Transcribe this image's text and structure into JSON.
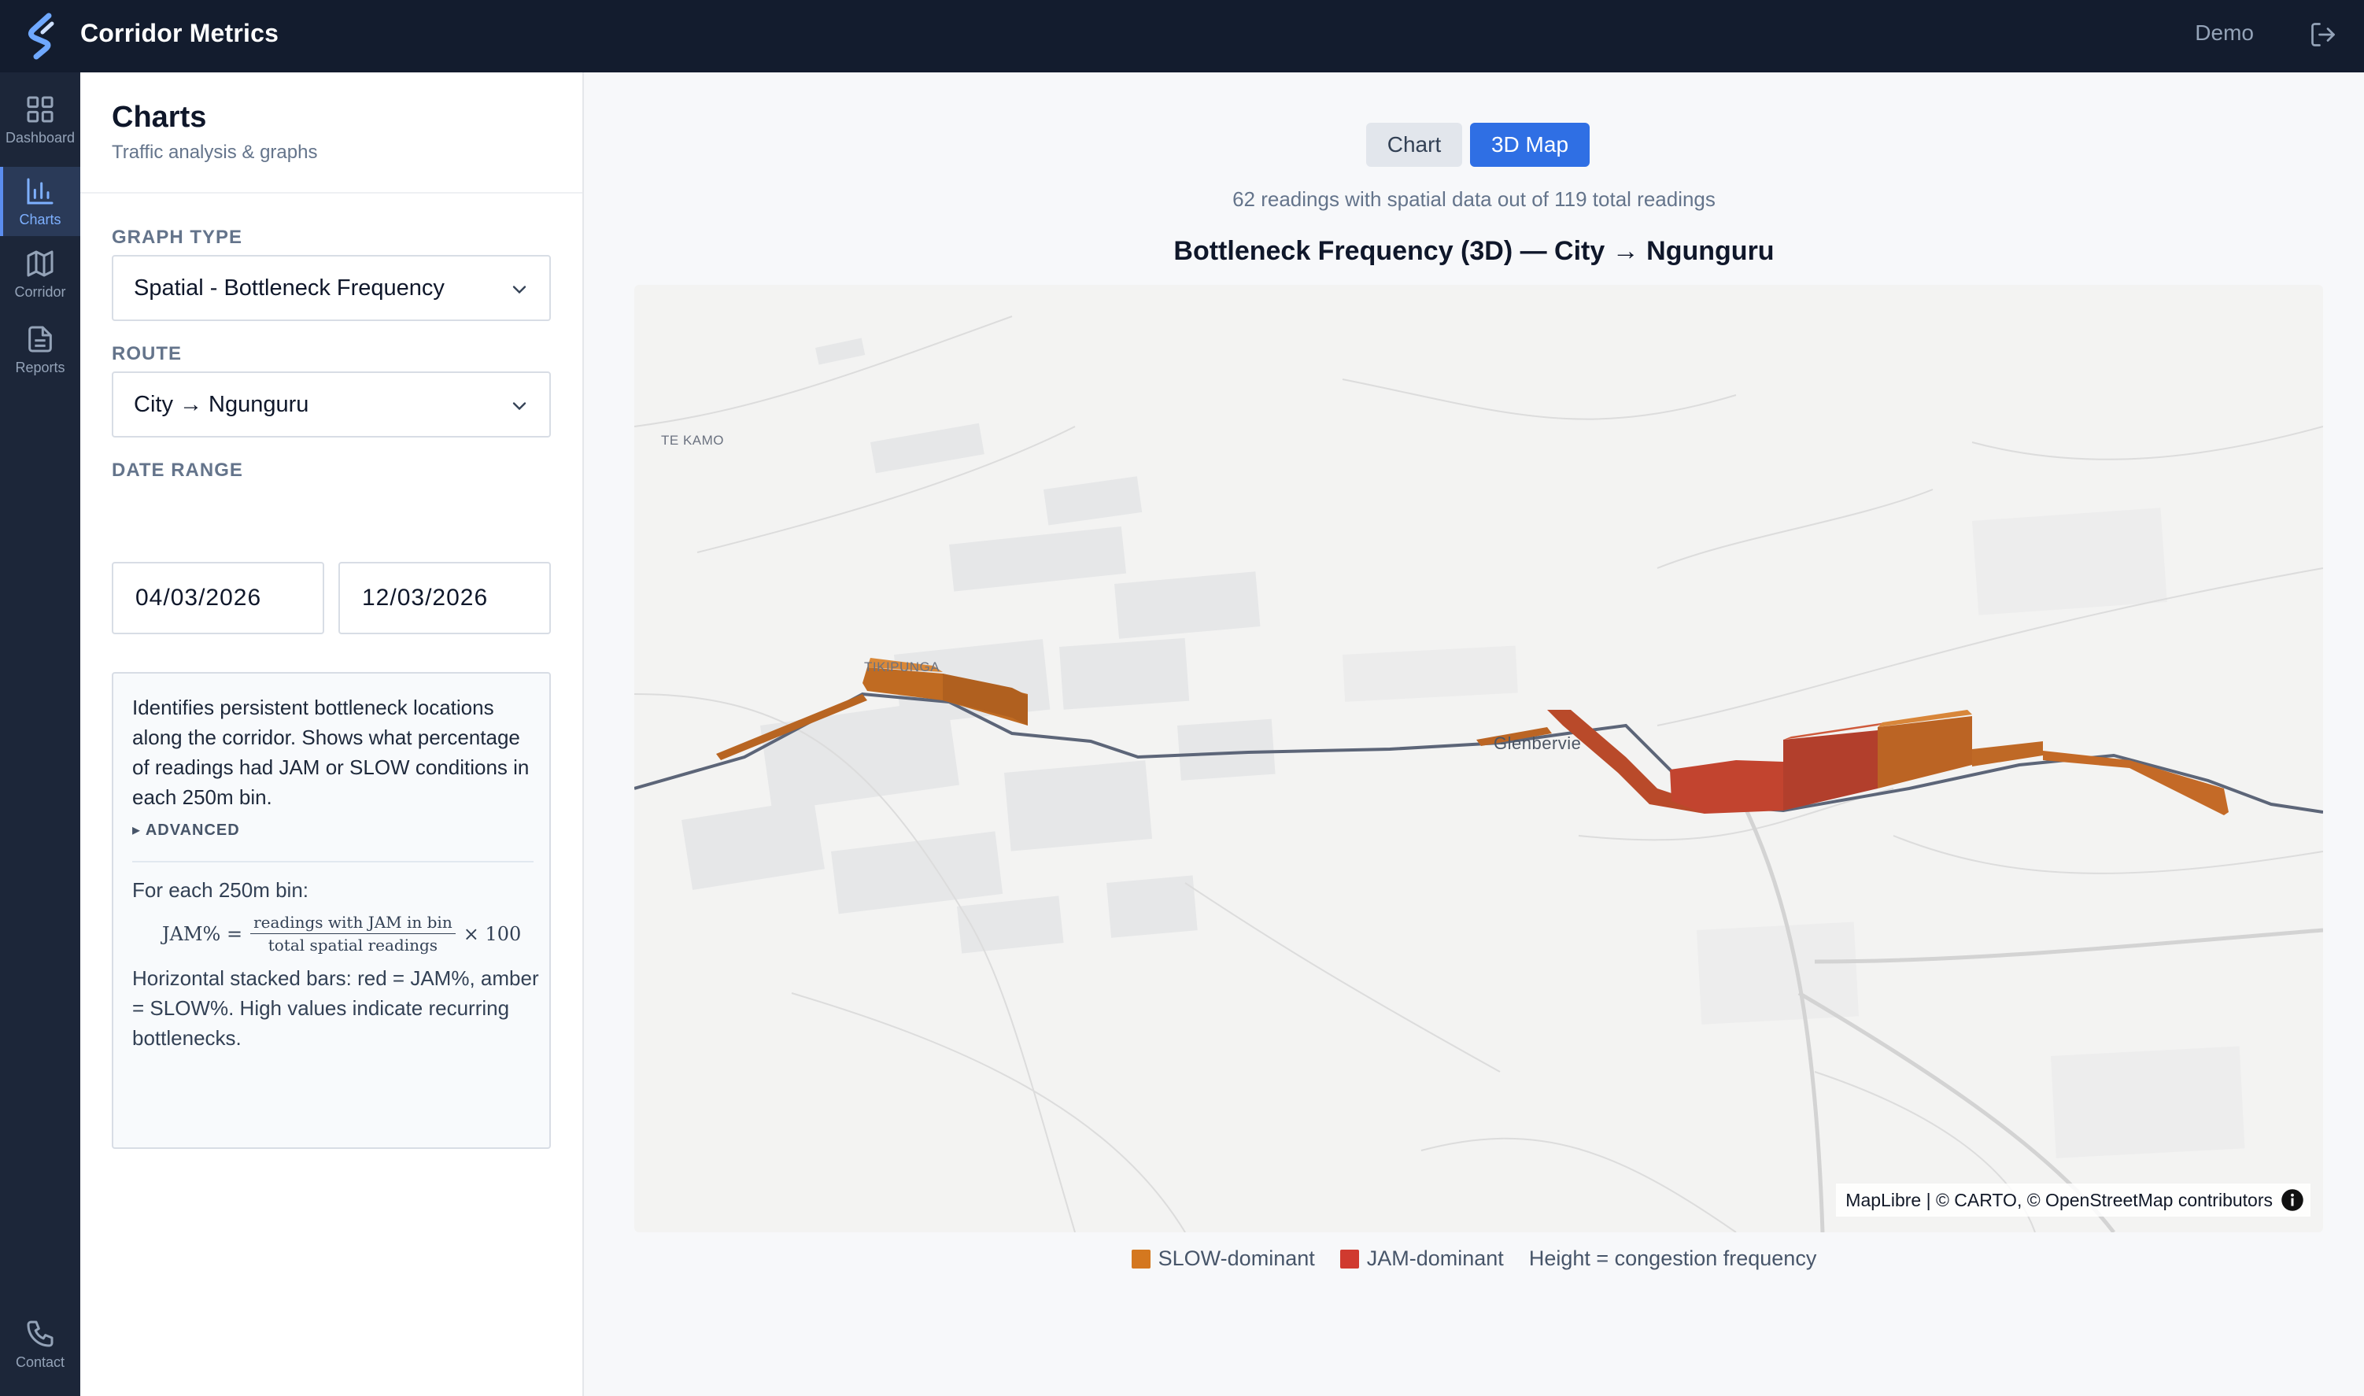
{
  "app": {
    "title": "Corridor Metrics",
    "user": "Demo"
  },
  "nav": {
    "items": [
      {
        "label": "Dashboard",
        "icon": "grid-icon"
      },
      {
        "label": "Charts",
        "icon": "bar-chart-icon",
        "active": true
      },
      {
        "label": "Corridor",
        "icon": "map-icon"
      },
      {
        "label": "Reports",
        "icon": "document-icon"
      },
      {
        "label": "Contact",
        "icon": "phone-icon"
      }
    ]
  },
  "panel": {
    "title": "Charts",
    "subtitle": "Traffic analysis & graphs",
    "graph_type_label": "GRAPH TYPE",
    "graph_type_value": "Spatial - Bottleneck Frequency",
    "route_label": "ROUTE",
    "route_value": "City → Ngunguru",
    "date_label": "DATE RANGE",
    "date_from": "04/03/2026",
    "date_to": "12/03/2026",
    "info": {
      "description": "Identifies persistent bottleneck locations along the corridor. Shows what percentage of readings had JAM or SLOW conditions in each 250m bin.",
      "advanced": "▸ ADVANCED",
      "each_bin": "For each 250m bin:",
      "formula_lhs": "JAM% =",
      "formula_num": "readings with JAM in bin",
      "formula_den": "total spatial readings",
      "formula_rhs": "× 100",
      "footer": "Horizontal stacked bars: red = JAM%, amber = SLOW%. High values indicate recurring bottlenecks."
    }
  },
  "main": {
    "tabs": {
      "chart": "Chart",
      "map": "3D Map"
    },
    "readings_text": "62 readings with spatial data out of 119 total readings",
    "title": "Bottleneck Frequency (3D) — City → Ngunguru",
    "places": {
      "te_kamo": "TE KAMO",
      "tikipunga": "TIKIPUNGA",
      "glenbervie": "Glenbervie"
    },
    "attribution": "MapLibre | © CARTO, © OpenStreetMap contributors",
    "legend": {
      "slow": "SLOW-dominant",
      "jam": "JAM-dominant",
      "height": "Height = congestion frequency"
    }
  },
  "colors": {
    "slow": "#d4781f",
    "jam": "#d03a2f",
    "accent": "#2f6fe4",
    "topbar": "#131c2e",
    "rail": "#1c2639"
  }
}
